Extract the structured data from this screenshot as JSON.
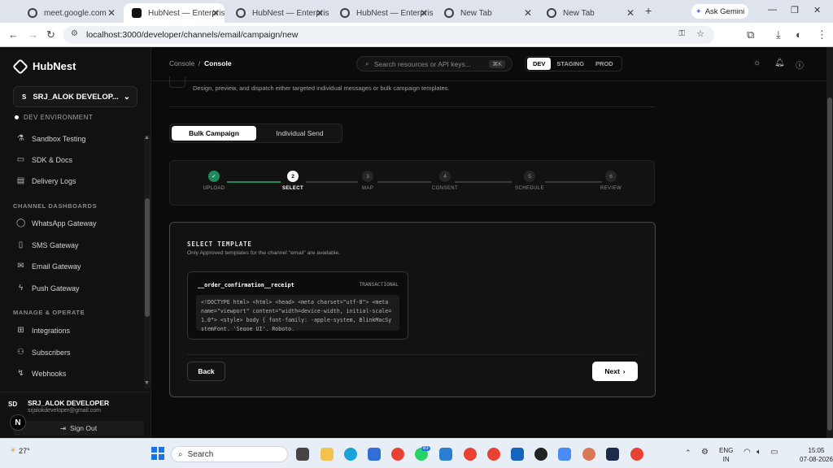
{
  "browser": {
    "tabs": [
      {
        "title": "meet.google.com"
      },
      {
        "title": "HubNest — Enterprise"
      },
      {
        "title": "HubNest — Enterprise"
      },
      {
        "title": "HubNest — Enterprise"
      },
      {
        "title": "New Tab"
      },
      {
        "title": "New Tab"
      }
    ],
    "gemini_label": "Ask Gemini",
    "url": "localhost:3000/developer/channels/email/campaign/new"
  },
  "sidebar": {
    "brand": "HubNest",
    "workspace_badge": "S",
    "workspace": "SRJ_ALOK DEVELOP...",
    "environment": "DEV ENVIRONMENT",
    "items_top": [
      {
        "label": "Sandbox Testing",
        "icon": "flask-icon"
      },
      {
        "label": "SDK & Docs",
        "icon": "book-icon"
      },
      {
        "label": "Delivery Logs",
        "icon": "log-icon"
      }
    ],
    "section_channels": "CHANNEL DASHBOARDS",
    "channels": [
      {
        "label": "WhatsApp Gateway",
        "icon": "chat-icon"
      },
      {
        "label": "SMS Gateway",
        "icon": "phone-icon"
      },
      {
        "label": "Email Gateway",
        "icon": "mail-icon"
      },
      {
        "label": "Push Gateway",
        "icon": "bolt-icon"
      }
    ],
    "section_manage": "MANAGE & OPERATE",
    "manage": [
      {
        "label": "Integrations",
        "icon": "plug-icon"
      },
      {
        "label": "Subscribers",
        "icon": "users-icon"
      },
      {
        "label": "Webhooks",
        "icon": "webhook-icon"
      }
    ],
    "user": {
      "initials": "SD",
      "name": "SRJ_ALOK DEVELOPER",
      "email": "srjalokdeveloper@gmail.com",
      "sign_out": "Sign Out"
    }
  },
  "topbar": {
    "crumb_parent": "Console",
    "crumb_sep": "/",
    "crumb_current": "Console",
    "search_placeholder": "Search resources or API keys...",
    "search_shortcut": "⌘K",
    "env_options": [
      "DEV",
      "STAGING",
      "PROD"
    ],
    "env_selected": "DEV"
  },
  "page": {
    "subtitle": "Design, preview, and dispatch either targeted individual messages or bulk campaign templates.",
    "modes": [
      "Bulk Campaign",
      "Individual Send"
    ],
    "mode_selected": "Bulk Campaign",
    "steps": [
      {
        "num": "✓",
        "label": "UPLOAD",
        "state": "done"
      },
      {
        "num": "2",
        "label": "SELECT",
        "state": "current"
      },
      {
        "num": "3",
        "label": "MAP",
        "state": "todo"
      },
      {
        "num": "4",
        "label": "CONSENT",
        "state": "todo"
      },
      {
        "num": "5",
        "label": "SCHEDULE",
        "state": "todo"
      },
      {
        "num": "6",
        "label": "REVIEW",
        "state": "todo"
      }
    ],
    "card_title": "SELECT TEMPLATE",
    "card_subtitle": "Only Approved templates for the channel \"email\" are available.",
    "template": {
      "name": "__order_confirmation__receipt",
      "category": "TRANSACTIONAL",
      "preview": "<!DOCTYPE html> <html> <head> <meta charset=\"utf-8\"> <meta name=\"viewport\" content=\"width=device-width, initial-scale=1.0\"> <style> body { font-family: -apple-system, BlinkMacSystemFont, 'Segoe UI', Roboto,"
    },
    "back_label": "Back",
    "next_label": "Next"
  },
  "taskbar": {
    "search": "Search",
    "weather": "27°",
    "badge_count": "83",
    "lang_top": "ENG",
    "lang_bottom": "IN",
    "time": "15:05",
    "date": "07-08-2026"
  },
  "colors": {
    "accent_green": "#1f8a5b",
    "bg": "#0b0b0b"
  }
}
